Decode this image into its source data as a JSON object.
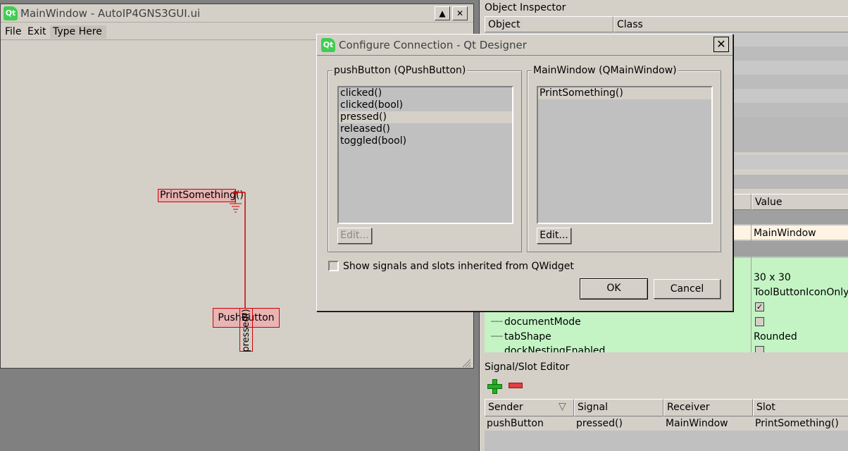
{
  "designer_window": {
    "title": "MainWindow - AutoIP4GNS3GUI.ui",
    "logo": "Qt",
    "minimize_label": "▲",
    "close_label": "✕",
    "menu": [
      "File",
      "Exit",
      "Type Here"
    ]
  },
  "canvas": {
    "slot_label": "PrintSomething()",
    "button_label": "PushButton",
    "signal_label": "pressed()"
  },
  "object_inspector": {
    "title": "Object Inspector",
    "columns": [
      "Object",
      "Class"
    ]
  },
  "property_editor": {
    "value_header": "Value",
    "rows": [
      {
        "name": "",
        "value": "MainWindow"
      },
      {
        "name": "",
        "value": "30 x 30"
      },
      {
        "name": "",
        "value": "ToolButtonIconOnly"
      },
      {
        "name": "",
        "value": "checked"
      },
      {
        "name": "documentMode",
        "value": "unchecked"
      },
      {
        "name": "tabShape",
        "value": "Rounded"
      },
      {
        "name": "dockNestingEnabled",
        "value": "unchecked"
      }
    ]
  },
  "signal_slot_editor": {
    "title": "Signal/Slot Editor",
    "add_icon": "plus-icon",
    "remove_icon": "minus-icon",
    "columns": [
      "Sender",
      "Signal",
      "Receiver",
      "Slot"
    ],
    "rows": [
      {
        "sender": "pushButton",
        "signal": "pressed()",
        "receiver": "MainWindow",
        "slot": "PrintSomething()"
      }
    ]
  },
  "dialog": {
    "title": "Configure Connection - Qt Designer",
    "left_group": {
      "title": "pushButton (QPushButton)",
      "items": [
        "clicked()",
        "clicked(bool)",
        "pressed()",
        "released()",
        "toggled(bool)"
      ],
      "selected_index": 2,
      "edit_label": "Edit..."
    },
    "right_group": {
      "title": "MainWindow (QMainWindow)",
      "items": [
        "PrintSomething()"
      ],
      "selected_index": 0,
      "edit_label": "Edit..."
    },
    "inherited_checkbox_label": "Show signals and slots inherited from QWidget",
    "ok_label": "OK",
    "cancel_label": "Cancel"
  },
  "colors": {
    "design_selection": "#d00000",
    "property_green": "#c4f4c4",
    "window_bg": "#d4d0c8"
  }
}
